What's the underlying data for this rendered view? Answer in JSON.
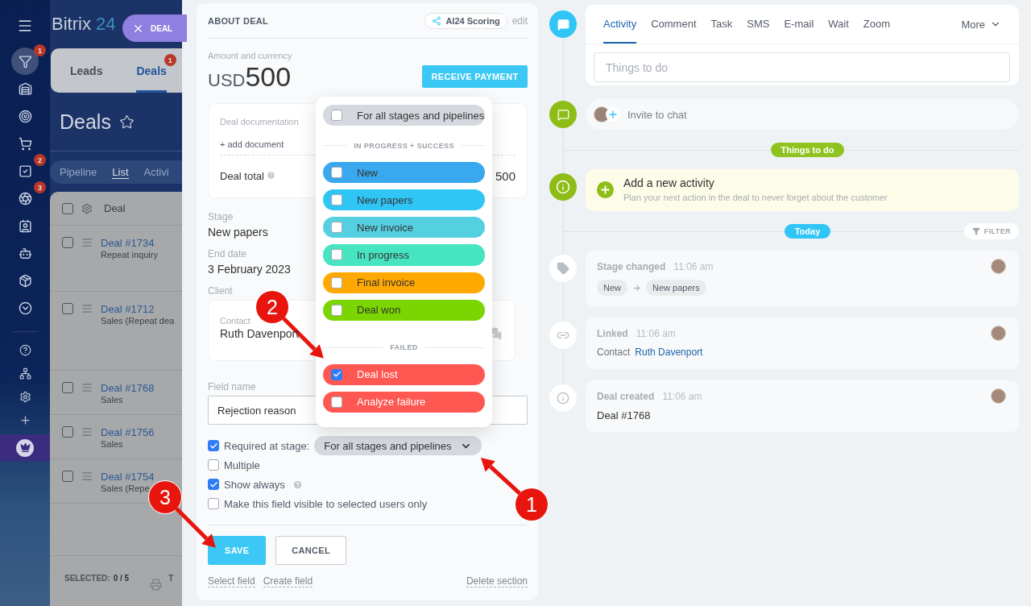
{
  "sidebar": {
    "items": [
      {
        "selected": true,
        "badge": "1"
      },
      {
        "selected": false
      },
      {
        "selected": false
      },
      {
        "selected": false
      },
      {
        "selected": false,
        "badge": "2"
      },
      {
        "selected": false,
        "badge": "3"
      },
      {
        "selected": false
      },
      {
        "selected": false
      },
      {
        "selected": false
      },
      {
        "selected": false
      }
    ]
  },
  "logo": {
    "name": "Bitrix",
    "number": "24"
  },
  "close_tab": {
    "label": "DEAL"
  },
  "crm_tabs": [
    {
      "label": "Leads",
      "selected": false
    },
    {
      "label": "Deals",
      "selected": true,
      "badge": "1"
    }
  ],
  "page_title": "Deals",
  "view_tabs": [
    {
      "label": "Pipeline",
      "selected": false
    },
    {
      "label": "List",
      "selected": true
    },
    {
      "label": "Activi",
      "selected": false
    }
  ],
  "deals_table": {
    "column": "Deal",
    "select_all_checked": false,
    "rows": [
      {
        "title": "Deal #1734",
        "subtitle": "Repeat inquiry",
        "checked": false
      },
      {
        "title": "Deal #1712",
        "subtitle": "Sales (Repeat dea",
        "checked": false
      },
      {
        "title": "Deal #1768",
        "subtitle": "Sales",
        "checked": false
      },
      {
        "title": "Deal #1756",
        "subtitle": "Sales",
        "checked": false
      },
      {
        "title": "Deal #1754",
        "subtitle": "Sales (Repe",
        "checked": false
      }
    ],
    "footer": {
      "selected_label": "SELECTED:",
      "selected_value": "0 / 5",
      "extra": "T"
    }
  },
  "about_deal": {
    "title": "ABOUT DEAL",
    "scoring": "AI24 Scoring",
    "edit": "edit",
    "amount_label": "Amount and currency",
    "currency": "USD",
    "amount": "500",
    "payment_button": "RECEIVE PAYMENT",
    "documents": {
      "label": "Deal documentation",
      "add": "+ add document",
      "total_label": "Deal total",
      "total_value": "500"
    },
    "fields": [
      {
        "label": "Stage",
        "value": "New papers"
      },
      {
        "label": "End date",
        "value": "3 February 2023"
      }
    ],
    "client": {
      "label": "Client",
      "contact_label": "Contact",
      "contact_name": "Ruth Davenport"
    }
  },
  "field_editor": {
    "name_label": "Field name",
    "name_value": "Rejection reason",
    "stage_select": "For all stages and pipelines",
    "options": [
      {
        "label": "Required at stage:",
        "checked": true,
        "kind": "stage"
      },
      {
        "label": "Multiple",
        "checked": false,
        "kind": "plain"
      },
      {
        "label": "Show always",
        "checked": true,
        "kind": "hint"
      },
      {
        "label": "Make this field visible to selected users only",
        "checked": false,
        "kind": "plain"
      }
    ],
    "buttons": [
      {
        "label": "SAVE",
        "kind": "primary"
      },
      {
        "label": "CANCEL",
        "kind": "secondary"
      }
    ],
    "links": [
      "Select field",
      "Create field",
      "Delete section"
    ]
  },
  "stage_menu": {
    "all": {
      "label": "For all stages and pipelines",
      "checked": false
    },
    "groups": [
      {
        "title": "IN PROGRESS + SUCCESS",
        "stages": [
          {
            "label": "New",
            "color": "#39a8ef",
            "checked": false
          },
          {
            "label": "New papers",
            "color": "#2fc6f6",
            "checked": false
          },
          {
            "label": "New invoice",
            "color": "#55d0e0",
            "checked": false
          },
          {
            "label": "In progress",
            "color": "#47e4c2",
            "checked": false
          },
          {
            "label": "Final invoice",
            "color": "#ffa900",
            "checked": false
          },
          {
            "label": "Deal won",
            "color": "#7bd500",
            "checked": false
          }
        ]
      },
      {
        "title": "FAILED",
        "stages": [
          {
            "label": "Deal lost",
            "color": "#ff5752",
            "checked": true
          },
          {
            "label": "Analyze failure",
            "color": "#ff5752",
            "checked": false
          }
        ]
      }
    ]
  },
  "timeline": {
    "tabs": [
      {
        "label": "Activity",
        "selected": true
      },
      {
        "label": "Comment",
        "selected": false
      },
      {
        "label": "Task",
        "selected": false
      },
      {
        "label": "SMS",
        "selected": false
      },
      {
        "label": "E-mail",
        "selected": false
      },
      {
        "label": "Wait",
        "selected": false
      },
      {
        "label": "Zoom",
        "selected": false
      }
    ],
    "more": "More",
    "input_placeholder": "Things to do",
    "invite": "Invite to chat",
    "things_badge": "Things to do",
    "add_activity": {
      "title": "Add a new activity",
      "text": "Plan your next action in the deal to never forget about the customer"
    },
    "today": "Today",
    "filter": "FILTER",
    "events": [
      {
        "kind": "stage",
        "title": "Stage changed",
        "time": "11:06 am",
        "from": "New",
        "to": "New papers"
      },
      {
        "kind": "link",
        "title": "Linked",
        "time": "11:06 am",
        "prefix": "Contact",
        "link": "Ruth Davenport"
      },
      {
        "kind": "info",
        "title": "Deal created",
        "time": "11:06 am",
        "text": "Deal #1768"
      }
    ]
  },
  "annotations": [
    {
      "number": "1"
    },
    {
      "number": "2"
    },
    {
      "number": "3"
    }
  ]
}
